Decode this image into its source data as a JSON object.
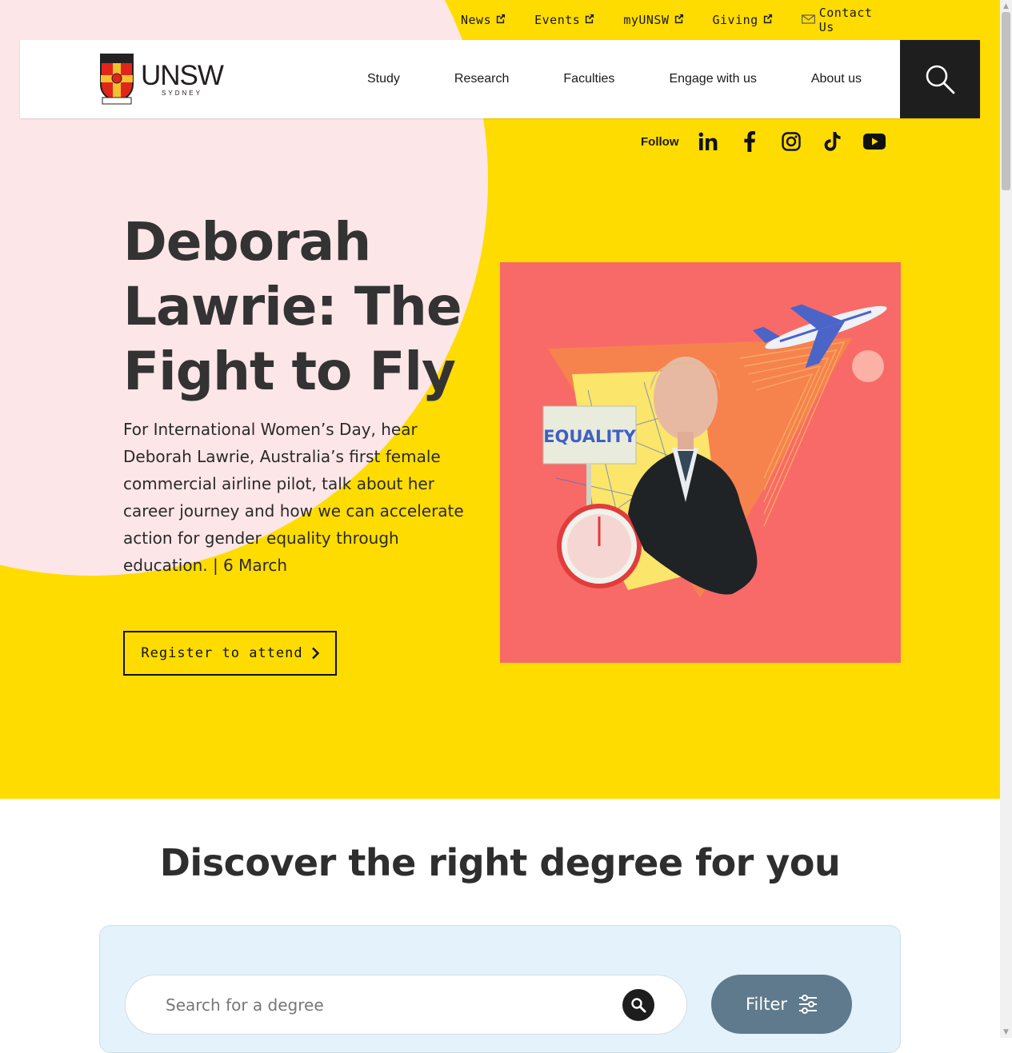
{
  "utility_nav": {
    "items": [
      {
        "label": "News",
        "icon": "external-link-icon"
      },
      {
        "label": "Events",
        "icon": "external-link-icon"
      },
      {
        "label": "myUNSW",
        "icon": "external-link-icon"
      },
      {
        "label": "Giving",
        "icon": "external-link-icon"
      },
      {
        "label": "Contact Us",
        "icon": "envelope-icon"
      }
    ]
  },
  "header": {
    "logo": {
      "wordmark": "UNSW",
      "sub": "SYDNEY"
    },
    "nav": [
      {
        "label": "Study"
      },
      {
        "label": "Research"
      },
      {
        "label": "Faculties"
      },
      {
        "label": "Engage with us"
      },
      {
        "label": "About us"
      }
    ],
    "search_icon": "search-icon"
  },
  "social": {
    "label": "Follow",
    "items": [
      "linkedin-icon",
      "facebook-icon",
      "instagram-icon",
      "tiktok-icon",
      "youtube-icon"
    ]
  },
  "hero": {
    "title": "Deborah Lawrie: The Fight to Fly",
    "description": "For International Women’s Day, hear Deborah Lawrie, Australia’s first female commercial airline pilot, talk about her career journey and how we can accelerate action for gender equality through education. | 6 March",
    "cta_label": "Register to attend",
    "image_sign_text": "EQUALITY",
    "colors": {
      "background": "#ffdc00",
      "accent_pink": "#fde6e7",
      "image_bg": "#f86a67"
    }
  },
  "degree_finder": {
    "title": "Discover the right degree for you",
    "search_placeholder": "Search for a degree",
    "search_value": "",
    "filter_label": "Filter"
  }
}
